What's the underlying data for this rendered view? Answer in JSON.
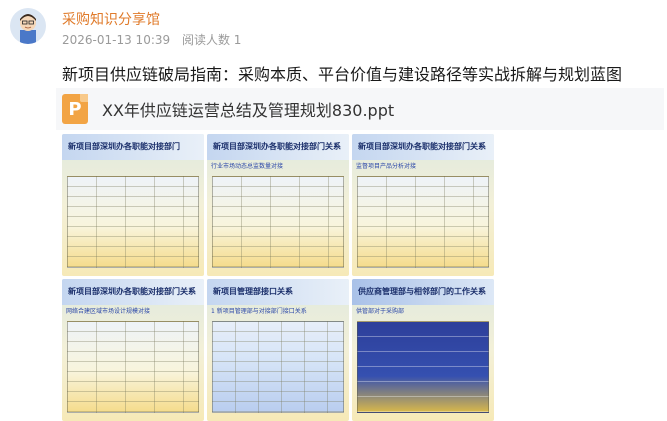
{
  "post": {
    "author": "采购知识分享馆",
    "date": "2026-01-13 10:39",
    "read_label": "阅读人数 1",
    "title": "新项目供应链破局指南：采购本质、平台价值与建设路径等实战拆解与规划蓝图"
  },
  "attachment": {
    "icon": "ppt-file-icon",
    "icon_letter": "P",
    "file_name": "XX年供应链运营总结及管理规划830.ppt"
  },
  "thumbnails": [
    {
      "heading": "新项目部深圳办各职能对接部门",
      "sub": ""
    },
    {
      "heading": "新项目部深圳办各职能对接部门关系",
      "sub": "行业市场动态总监数量对接"
    },
    {
      "heading": "新项目部深圳办各职能对接部门关系",
      "sub": "监督项目产品分析对接"
    },
    {
      "heading": "新项目部深圳办各职能对接部门关系",
      "sub": "网络合建区域市场设计规模对接"
    },
    {
      "heading": "新项目管理部接口关系",
      "sub": "1 新项目管理部与对接部门接口关系"
    },
    {
      "heading": "供应商管理部与相邻部门的工作关系",
      "sub": "供管部对于采购部"
    }
  ],
  "colors": {
    "author": "#e07b2b",
    "meta": "#9a9a9a",
    "icon": "#f2a445"
  }
}
